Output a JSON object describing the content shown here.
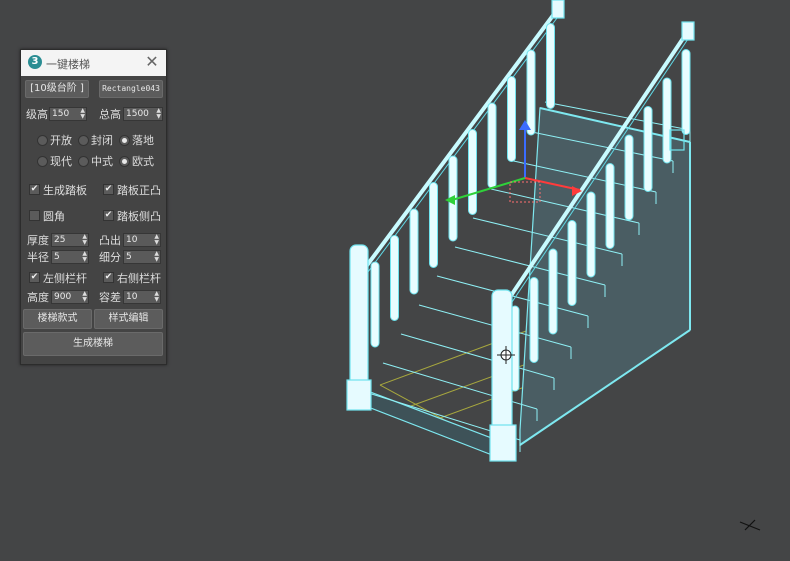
{
  "panel": {
    "title": "一键楼梯",
    "app_icon": "3",
    "close_glyph": "✕",
    "step_button": "[10级台阶 ]",
    "object_button": "Rectangle043",
    "step_height": {
      "label": "级高",
      "value": "150"
    },
    "total_height": {
      "label": "总高",
      "value": "1500"
    },
    "open_options": [
      {
        "label": "开放",
        "selected": false
      },
      {
        "label": "封闭",
        "selected": false
      },
      {
        "label": "落地",
        "selected": true
      }
    ],
    "style_options": [
      {
        "label": "现代",
        "selected": false
      },
      {
        "label": "中式",
        "selected": false
      },
      {
        "label": "欧式",
        "selected": true
      }
    ],
    "gen_tread": {
      "label": "生成踏板",
      "checked": true
    },
    "tread_front": {
      "label": "踏板正凸",
      "checked": true
    },
    "rounded": {
      "label": "圆角",
      "checked": false
    },
    "tread_side": {
      "label": "踏板侧凸",
      "checked": true
    },
    "thickness": {
      "label": "厚度",
      "value": "25"
    },
    "protrude": {
      "label": "凸出",
      "value": "10"
    },
    "radius": {
      "label": "半径",
      "value": "5"
    },
    "segments": {
      "label": "细分",
      "value": "5"
    },
    "left_rail": {
      "label": "左侧栏杆",
      "checked": true
    },
    "right_rail": {
      "label": "右侧栏杆",
      "checked": true
    },
    "height": {
      "label": "高度",
      "value": "900"
    },
    "tolerance": {
      "label": "容差",
      "value": "10"
    },
    "stair_style_button": "楼梯款式",
    "edit_style_button": "样式编辑",
    "generate_button": "生成楼梯",
    "check_glyph": "✔"
  },
  "colors": {
    "viewport_bg": "#444546",
    "wire": "#7ee8f0",
    "wire_dark": "#3bb4c4",
    "grid": "#c8c83c",
    "panel_bg": "#444444"
  }
}
